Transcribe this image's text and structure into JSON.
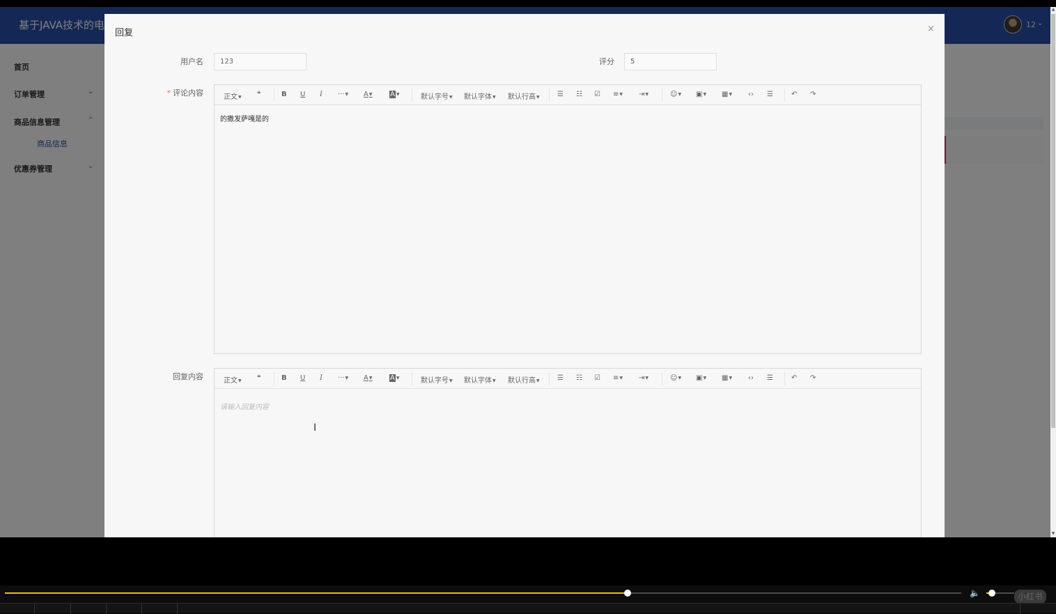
{
  "header": {
    "title": "基于JAVA技术的电",
    "user": "12"
  },
  "sidebar": {
    "items": [
      {
        "label": "首页"
      },
      {
        "label": "订单管理"
      },
      {
        "label": "商品信息管理"
      },
      {
        "label": "优惠券管理"
      }
    ],
    "sub_item": "商品信息"
  },
  "dialog": {
    "title": "回复",
    "close": "×",
    "fields": {
      "username_label": "用户名",
      "username_value": "123",
      "rating_label": "评分",
      "rating_value": "5",
      "comment_label": "评论内容",
      "comment_required": "*",
      "comment_text": "的撒发萨嘎是的",
      "reply_label": "回复内容",
      "reply_placeholder": "请输入回复内容"
    },
    "toolbar": {
      "paragraph": "正文",
      "quote": "❝",
      "bold": "B",
      "underline": "U",
      "italic": "I",
      "more": "···",
      "font_color": "A",
      "bg_color": "A",
      "font_size": "默认字号",
      "font_family": "默认字体",
      "line_height": "默认行高",
      "bullet_list": "☰",
      "number_list": "☷",
      "todo": "☑",
      "align": "≡",
      "indent": "⇥",
      "emoji": "☺",
      "image": "▣",
      "table": "▦",
      "code": "‹›",
      "divider": "☰",
      "undo": "↶",
      "redo": "↷"
    }
  },
  "player": {
    "progress": 0.651,
    "volume": 0.2,
    "watermark": "小红书"
  },
  "colors": {
    "header": "#2a4fa8",
    "accent": "#e7c21a"
  }
}
